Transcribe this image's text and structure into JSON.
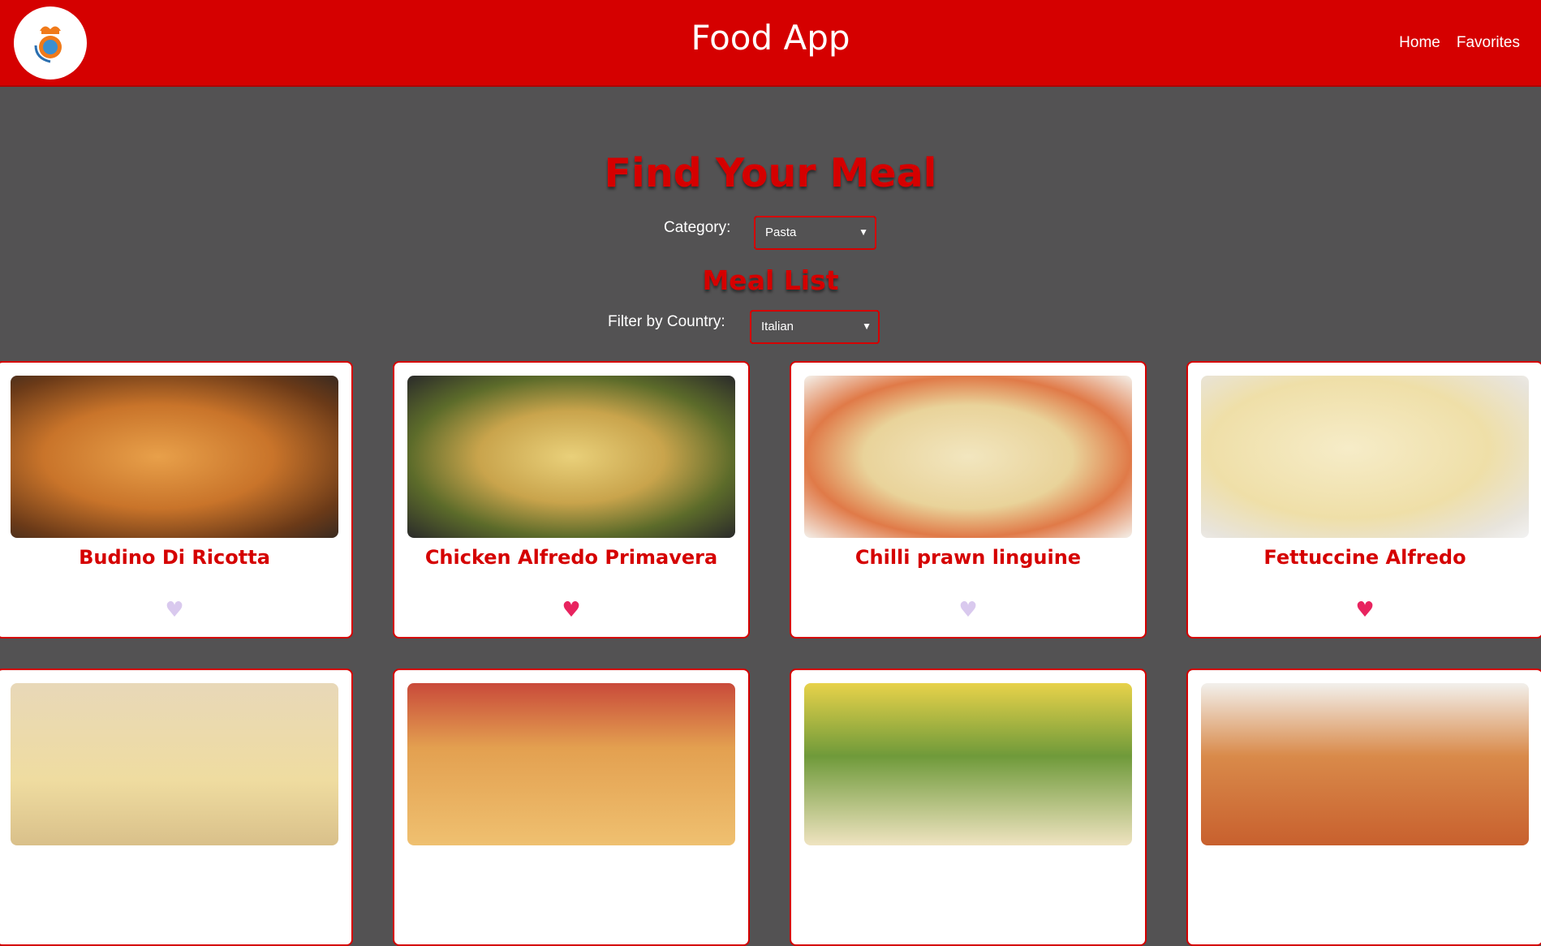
{
  "header": {
    "title": "Food App",
    "nav": [
      "Home",
      "Favorites"
    ]
  },
  "main": {
    "find_title": "Find Your Meal",
    "category_label": "Category:",
    "category_value": "Pasta",
    "meal_list_title": "Meal List",
    "country_label": "Filter by Country:",
    "country_value": "Italian"
  },
  "meals": [
    {
      "name": "Budino Di Ricotta",
      "favorite": false
    },
    {
      "name": "Chicken Alfredo Primavera",
      "favorite": true
    },
    {
      "name": "Chilli prawn linguine",
      "favorite": false
    },
    {
      "name": "Fettuccine Alfredo",
      "favorite": true
    },
    {
      "name": "",
      "favorite": false
    },
    {
      "name": "",
      "favorite": false
    },
    {
      "name": "",
      "favorite": false
    },
    {
      "name": "",
      "favorite": false
    }
  ],
  "colors": {
    "brand_red": "#d50000",
    "page_bg": "#535253",
    "heart_on": "#e8245f",
    "heart_off": "#d9c9ee"
  },
  "icons": {
    "logo": "chef-globe-logo",
    "favorite_on": "heart-filled-icon",
    "favorite_off": "heart-outline-icon",
    "select": "chevron-down-icon"
  }
}
